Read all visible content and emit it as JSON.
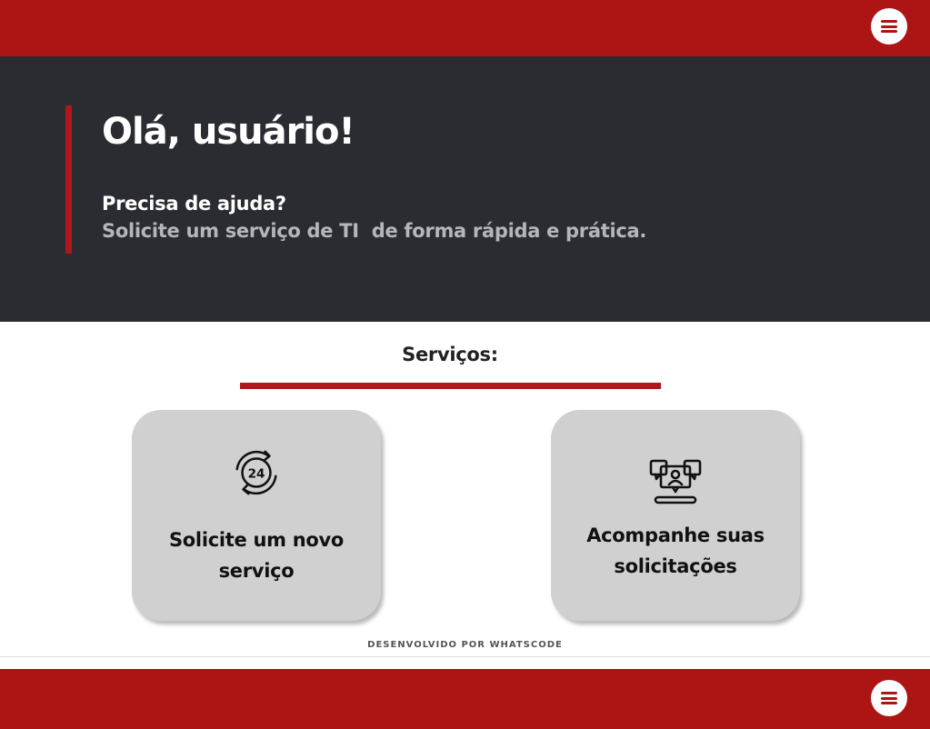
{
  "colors": {
    "brand_red": "#ad1515",
    "hero_bg": "#2b2c31",
    "card_bg": "#d0d0d0"
  },
  "header": {
    "menu_icon": "hamburger-menu-icon"
  },
  "hero": {
    "title": "Olá, usuário!",
    "question": "Precisa de ajuda?",
    "subtitle": "Solicite um serviço de TI  de forma rápida e prática."
  },
  "services": {
    "title": "Serviços:",
    "cards": [
      {
        "icon": "24-hours-icon",
        "line1": "Solicite um novo",
        "line2": "serviço"
      },
      {
        "icon": "chat-support-icon",
        "line1": "Acompanhe suas",
        "line2": "solicitações"
      }
    ]
  },
  "footer": {
    "credit": "DESENVOLVIDO POR WHATSCODE",
    "menu_icon": "hamburger-menu-icon"
  }
}
